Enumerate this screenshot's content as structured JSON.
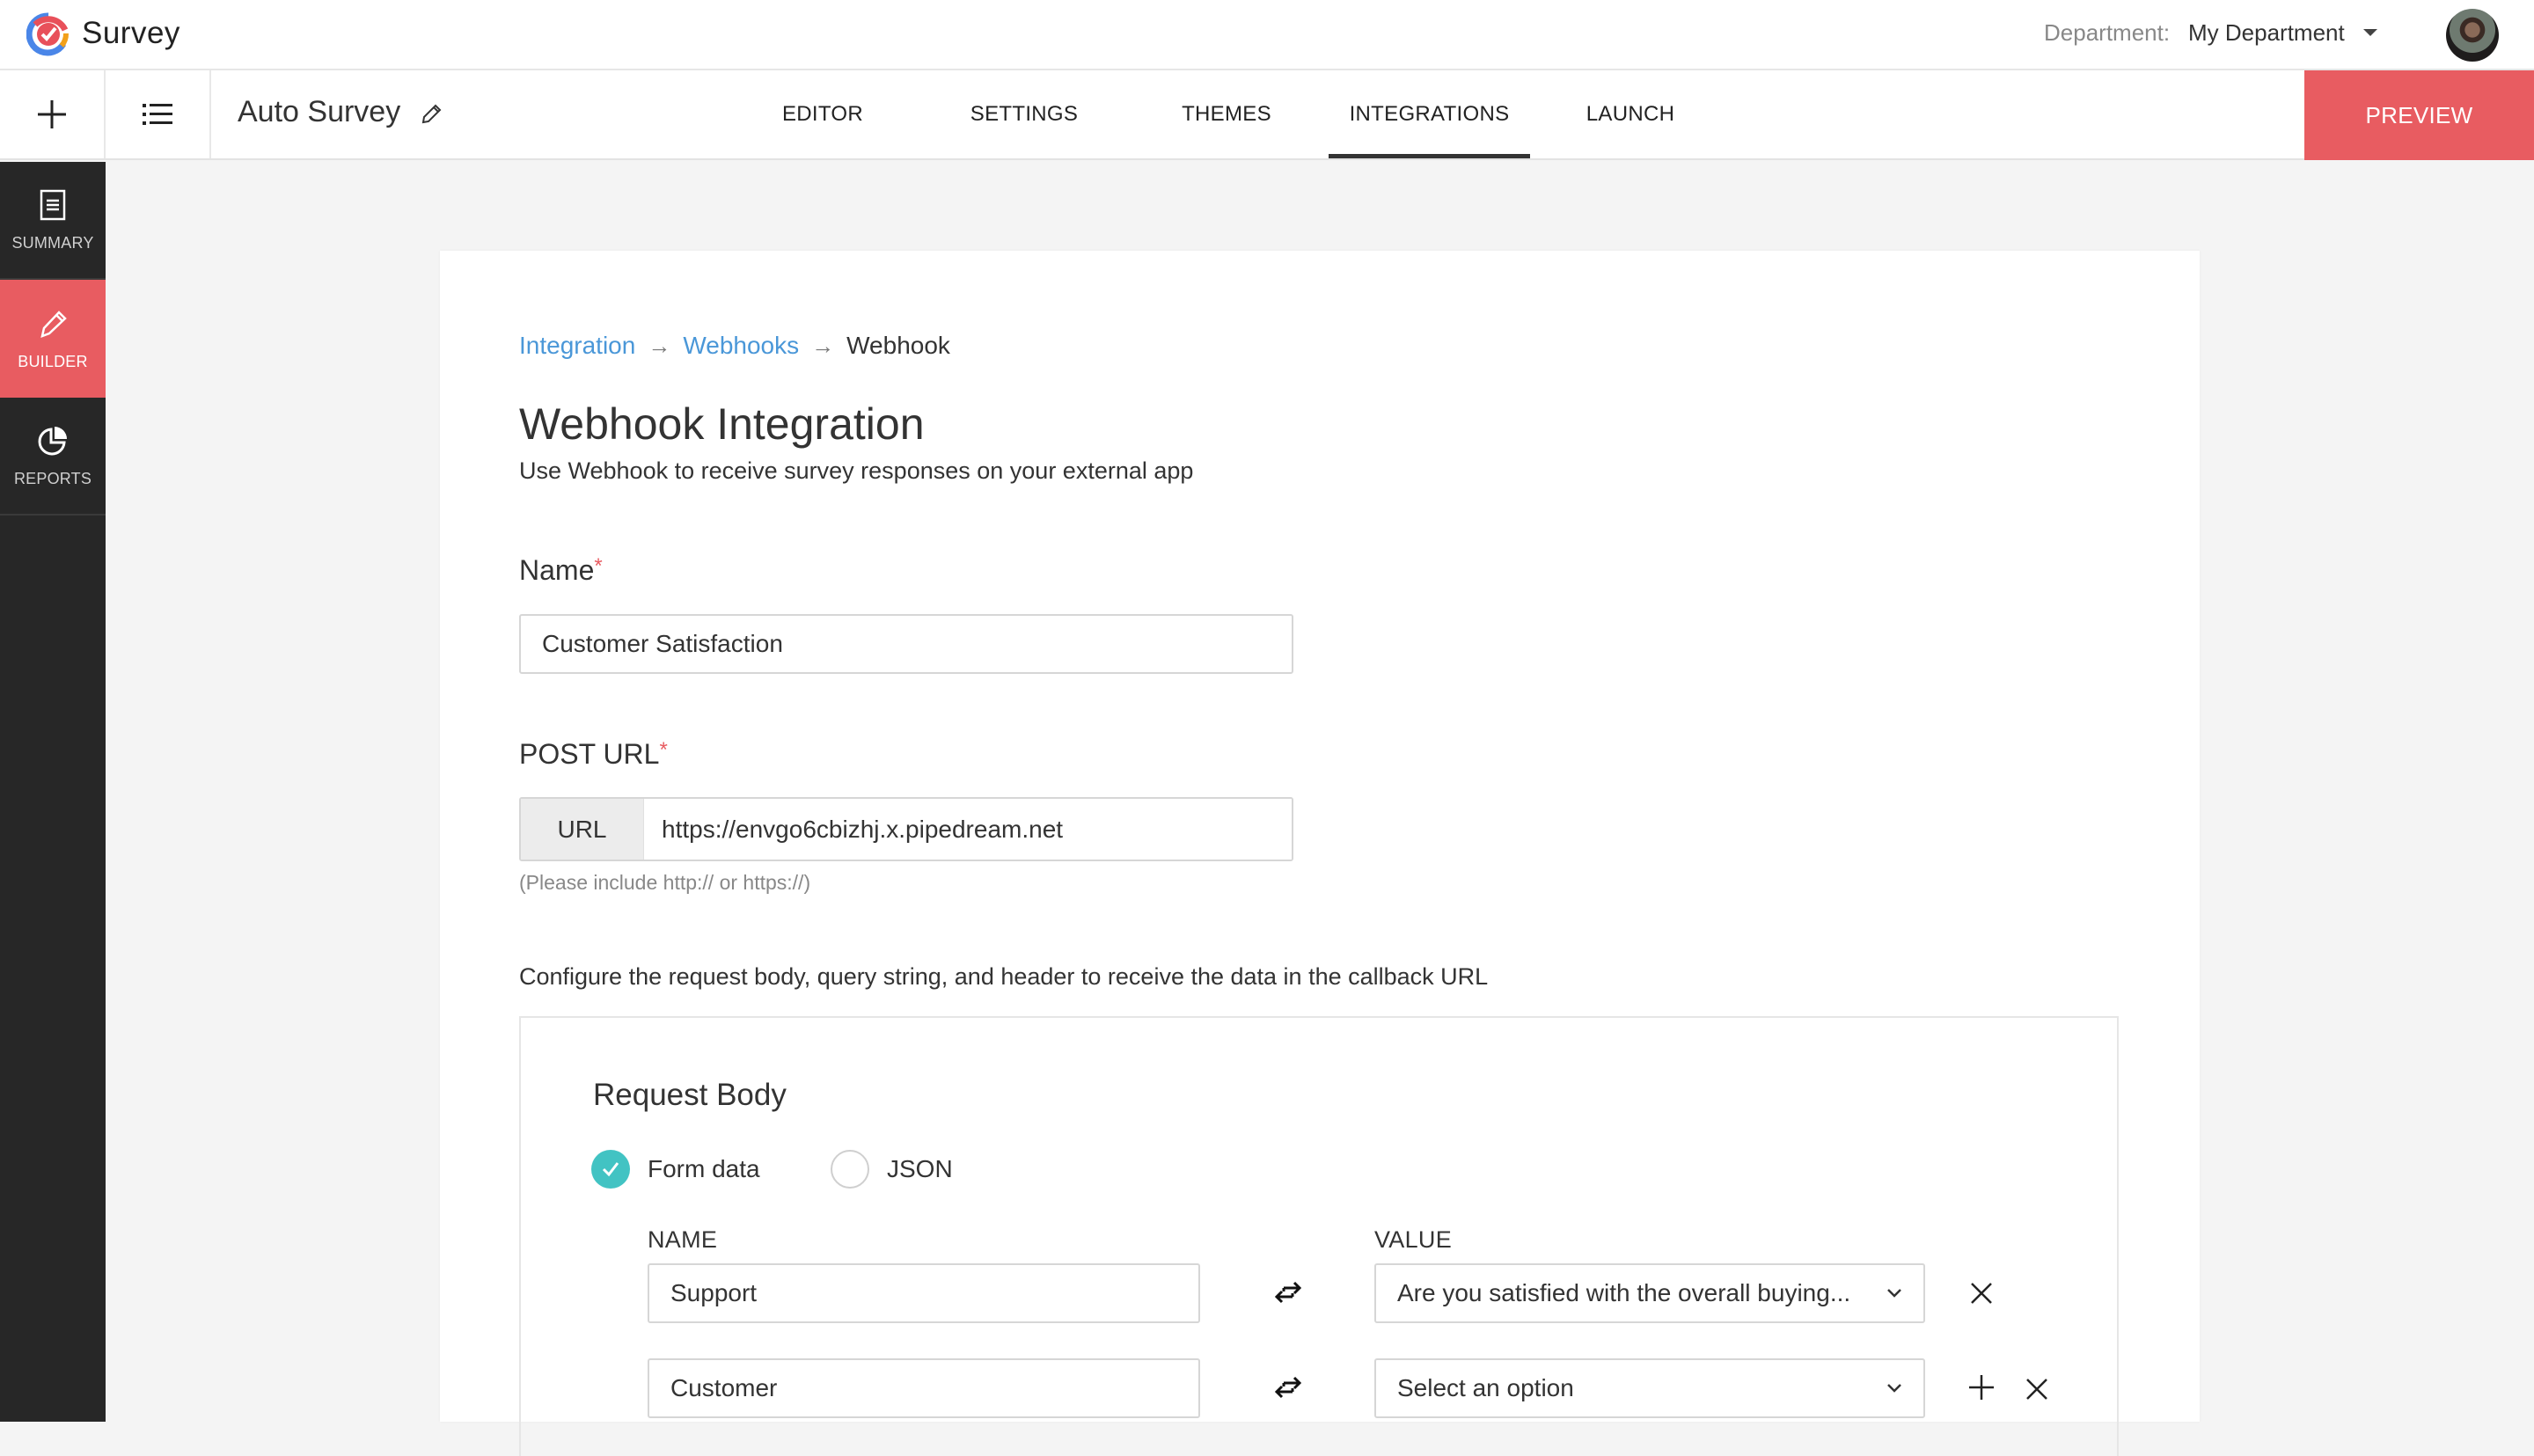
{
  "app": {
    "brand": "Survey",
    "department_label": "Department:",
    "department_value": "My Department"
  },
  "subheader": {
    "survey_name": "Auto Survey",
    "tabs": [
      {
        "label": "EDITOR",
        "active": false
      },
      {
        "label": "SETTINGS",
        "active": false
      },
      {
        "label": "THEMES",
        "active": false
      },
      {
        "label": "INTEGRATIONS",
        "active": true
      },
      {
        "label": "LAUNCH",
        "active": false
      }
    ],
    "preview_label": "PREVIEW"
  },
  "sidebar": {
    "items": [
      {
        "label": "SUMMARY",
        "icon": "document-icon",
        "active": false
      },
      {
        "label": "BUILDER",
        "icon": "pencil-icon",
        "active": true
      },
      {
        "label": "REPORTS",
        "icon": "pie-chart-icon",
        "active": false
      }
    ]
  },
  "breadcrumb": {
    "items": [
      "Integration",
      "Webhooks",
      "Webhook"
    ],
    "separator": "→"
  },
  "page": {
    "title": "Webhook Integration",
    "subtitle": "Use Webhook to receive survey responses on your external app"
  },
  "form": {
    "name_label": "Name",
    "name_value": "Customer Satisfaction",
    "required_mark": "*",
    "post_url_label": "POST URL",
    "url_addon": "URL",
    "url_value": "https://envgo6cbizhj.x.pipedream.net",
    "url_hint": "(Please include http:// or https://)",
    "configure_text": "Configure the request body, query string, and header to receive the data in the callback URL"
  },
  "request_body": {
    "title": "Request Body",
    "options": [
      {
        "label": "Form data",
        "checked": true
      },
      {
        "label": "JSON",
        "checked": false
      }
    ],
    "name_header": "NAME",
    "value_header": "VALUE",
    "rows": [
      {
        "name": "Support",
        "value": "Are you satisfied with the overall buying..."
      },
      {
        "name": "Customer",
        "value": "Select an option"
      }
    ]
  },
  "colors": {
    "accent": "#e85c61",
    "link": "#4a97d8",
    "radio_checked": "#42c3c3",
    "sidebar_bg": "#272727"
  }
}
